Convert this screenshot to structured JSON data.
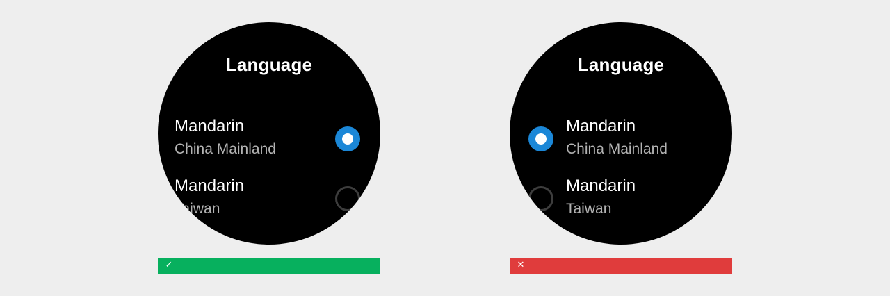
{
  "colors": {
    "background": "#eeeeee",
    "watch_face": "#000000",
    "selected_radio": "#1b87d7",
    "unselected_radio_border": "#3d3d3d",
    "secondary_text": "#b3b3b3",
    "do_bar": "#07b05e",
    "dont_bar": "#e03c3c"
  },
  "examples": [
    {
      "verdict": "do",
      "verdict_icon": "checkmark-icon",
      "verdict_glyph": "✓",
      "screen": {
        "title": "Language",
        "items": [
          {
            "primary": "Mandarin",
            "secondary": "China Mainland",
            "selected": true
          },
          {
            "primary": "Mandarin",
            "secondary": "Taiwan",
            "selected": false
          }
        ]
      }
    },
    {
      "verdict": "dont",
      "verdict_icon": "close-icon",
      "verdict_glyph": "✕",
      "screen": {
        "title": "Language",
        "items": [
          {
            "primary": "Mandarin",
            "secondary": "China Mainland",
            "selected": true
          },
          {
            "primary": "Mandarin",
            "secondary": "Taiwan",
            "selected": false
          }
        ]
      }
    }
  ]
}
